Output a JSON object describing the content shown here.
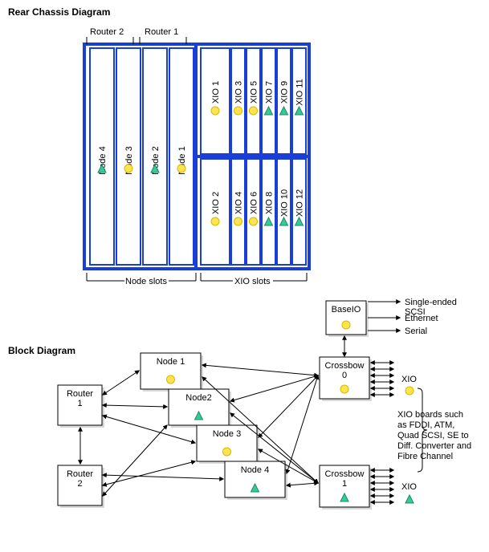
{
  "titles": {
    "rear_chassis": "Rear Chassis Diagram",
    "block": "Block Diagram"
  },
  "router_labels": {
    "r2": "Router 2",
    "r1": "Router 1"
  },
  "section_labels": {
    "node_slots": "Node slots",
    "xio_slots": "XIO slots"
  },
  "chassis": {
    "nodes": [
      {
        "name": "Node 4",
        "marker": "triangle"
      },
      {
        "name": "Node 3",
        "marker": "circle"
      },
      {
        "name": "Node 2",
        "marker": "triangle"
      },
      {
        "name": "Node 1",
        "marker": "circle"
      }
    ],
    "xio_top": [
      {
        "name": "XIO 1",
        "marker": "circle",
        "wide": true
      },
      {
        "name": "XIO 3",
        "marker": "circle"
      },
      {
        "name": "XIO 5",
        "marker": "circle"
      },
      {
        "name": "XIO 7",
        "marker": "triangle"
      },
      {
        "name": "XIO 9",
        "marker": "triangle"
      },
      {
        "name": "XIO 11",
        "marker": "triangle"
      }
    ],
    "xio_bottom": [
      {
        "name": "XIO 2",
        "marker": "circle",
        "wide": true
      },
      {
        "name": "XIO 4",
        "marker": "circle"
      },
      {
        "name": "XIO 6",
        "marker": "circle"
      },
      {
        "name": "XIO 8",
        "marker": "triangle"
      },
      {
        "name": "XIO 10",
        "marker": "triangle"
      },
      {
        "name": "XIO 12",
        "marker": "triangle"
      }
    ]
  },
  "block": {
    "routers": [
      "Router\n1",
      "Router\n2"
    ],
    "nodes": [
      {
        "name": "Node 1",
        "marker": "circle"
      },
      {
        "name": "Node2",
        "marker": "triangle"
      },
      {
        "name": "Node 3",
        "marker": "circle"
      },
      {
        "name": "Node 4",
        "marker": "triangle"
      }
    ],
    "crossbows": [
      {
        "name": "Crossbow\n0",
        "marker": "circle"
      },
      {
        "name": "Crossbow\n1",
        "marker": "triangle"
      }
    ],
    "baseio": {
      "name": "BaseIO",
      "marker": "circle"
    },
    "baseio_outputs": [
      "Single-ended\nSCSI",
      "Ethernet",
      "Serial"
    ],
    "xio_annotation": "XIO boards such\nas FDDI, ATM,\nQuad SCSI, SE to\nDiff. Converter and\nFibre Channel",
    "xio_label": "XIO"
  }
}
